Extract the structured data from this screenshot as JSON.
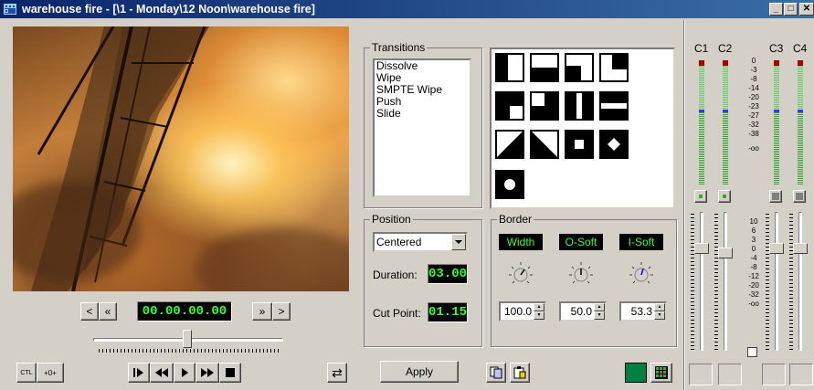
{
  "window": {
    "title": "warehouse fire - [\\1 - Monday\\12 Noon\\warehouse fire]",
    "min_glyph": "_",
    "max_glyph": "□",
    "close_glyph": "✕"
  },
  "transport": {
    "step_back": "<",
    "rewind_start": "«",
    "timecode": "00.00.00.00",
    "fast_forward_end": "»",
    "step_forward": ">",
    "ctl_label": "CTL",
    "zero_label": "+0+",
    "loop_glyph": "⇄"
  },
  "transitions": {
    "group_label": "Transitions",
    "items": [
      "Dissolve",
      "Wipe",
      "SMPTE Wipe",
      "Push",
      "Slide"
    ]
  },
  "position": {
    "group_label": "Position",
    "dropdown_value": "Centered",
    "duration_label": "Duration:",
    "duration_value": "03.00",
    "cut_point_label": "Cut Point:",
    "cut_point_value": "01.15"
  },
  "border": {
    "group_label": "Border",
    "width_label": "Width",
    "osoft_label": "O-Soft",
    "isoft_label": "I-Soft",
    "width_value": "100.0",
    "osoft_value": "50.0",
    "isoft_value": "53.3"
  },
  "apply_label": "Apply",
  "mixer": {
    "channels": [
      "C1",
      "C2",
      "C3",
      "C4"
    ],
    "meter_scale": [
      "0",
      "-3",
      "-8",
      "-14",
      "-20",
      "-23",
      "-27",
      "-32",
      "-38",
      "-oo"
    ],
    "fader_scale": [
      "10",
      "6",
      "3",
      "0",
      "-4",
      "-8",
      "-12",
      "-20",
      "-32",
      "-oo"
    ]
  },
  "colors": {
    "lcd_text": "#33ff33",
    "title_bar": "#0a246a",
    "green_indicator": "#008040"
  }
}
